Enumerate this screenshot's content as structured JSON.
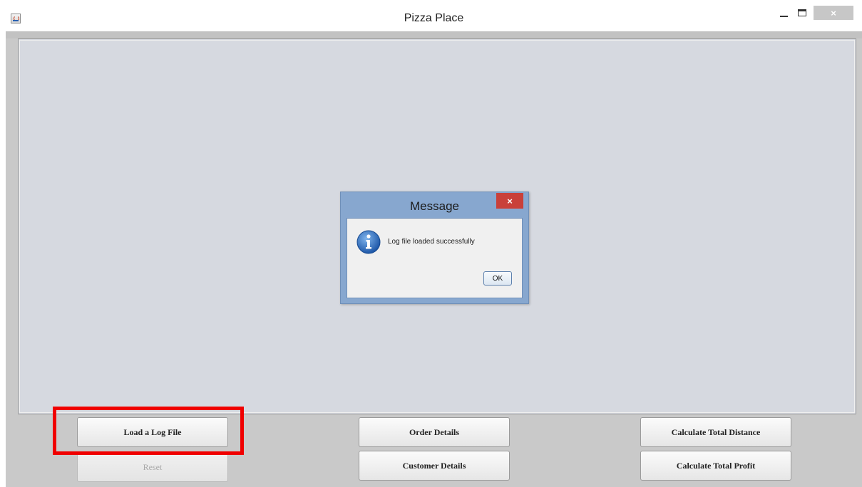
{
  "window": {
    "title": "Pizza Place",
    "close_glyph": "×"
  },
  "dialog": {
    "title": "Message",
    "close_glyph": "×",
    "icon": "info-icon",
    "message": "Log file loaded successfully",
    "ok_label": "OK"
  },
  "buttons": {
    "load_log_file": "Load a Log File",
    "reset": "Reset",
    "order_details": "Order Details",
    "customer_details": "Customer Details",
    "calc_total_distance": "Calculate Total Distance",
    "calc_total_profit": "Calculate Total Profit"
  },
  "colors": {
    "highlight": "#f00000",
    "dialog_frame": "#87a7cf",
    "dialog_close": "#c9403a",
    "panel_bg": "#d6d9e0"
  }
}
